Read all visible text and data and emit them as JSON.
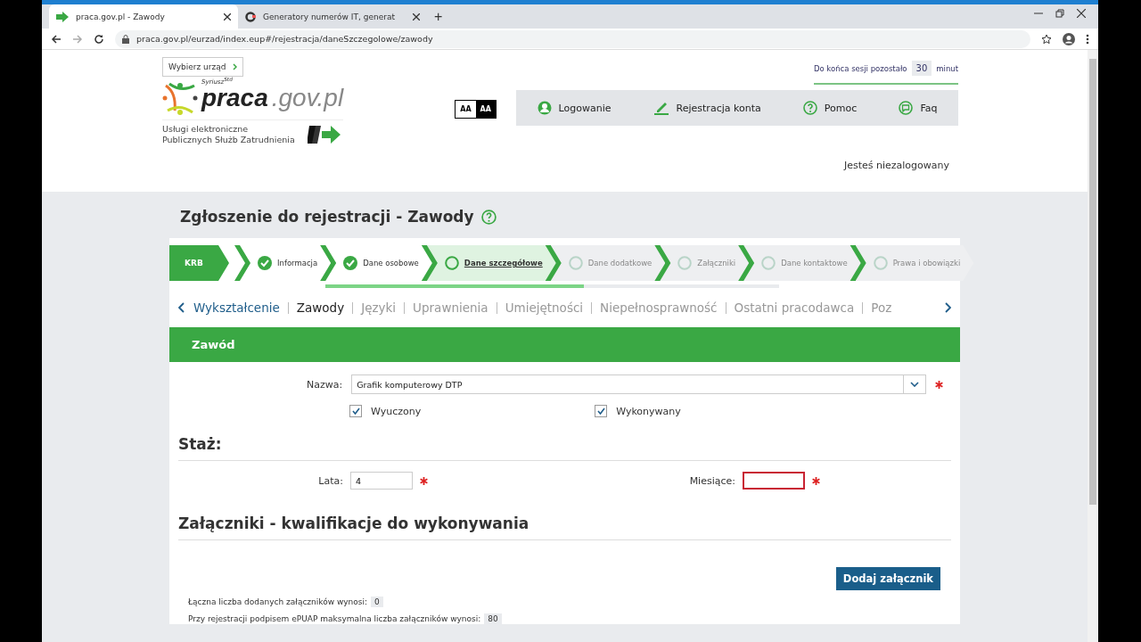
{
  "browser": {
    "tabs": [
      {
        "title": "praca.gov.pl - Zawody",
        "selected": true
      },
      {
        "title": "Generatory numerów IT, generat",
        "selected": false
      }
    ],
    "new_tab": "+",
    "address": "praca.gov.pl/eurzad/index.eup#/rejestracja/daneSzczegolowe/zawody"
  },
  "header": {
    "office_button": "Wybierz urząd",
    "logo": {
      "main": "praca",
      "domain": ".gov.pl",
      "badge": "Syriusz$^{Std}$",
      "subtitle": [
        "Usługi elektroniczne",
        "Publicznych Służb Zatrudnienia"
      ]
    },
    "contrast": [
      {
        "label": "AA",
        "selected": false
      },
      {
        "label": "AA",
        "selected": true
      }
    ],
    "session": {
      "prefix": "Do końca sesji pozostało",
      "minutes": "30",
      "suffix": "minut"
    },
    "nav": [
      {
        "label": "Logowanie"
      },
      {
        "label": "Rejestracja konta"
      },
      {
        "label": "Pomoc"
      },
      {
        "label": "Faq"
      }
    ],
    "login_status": "Jesteś niezalogowany"
  },
  "page_title": "Zgłoszenie do rejestracji - Zawody",
  "stepper": {
    "label": "KRB",
    "steps": [
      {
        "label": "Informacja",
        "completed": true,
        "selected": false
      },
      {
        "label": "Dane osobowe",
        "completed": true,
        "selected": false
      },
      {
        "label": "Dane szczegółowe",
        "completed": false,
        "selected": true
      },
      {
        "label": "Dane dodatkowe",
        "completed": false,
        "selected": false
      },
      {
        "label": "Załączniki",
        "completed": false,
        "selected": false
      },
      {
        "label": "Dane kontaktowe",
        "completed": false,
        "selected": false
      },
      {
        "label": "Prawa i obowiązki",
        "completed": false,
        "selected": false
      }
    ],
    "progress": {
      "level": 0.57
    }
  },
  "subtabs": [
    {
      "label": "Wykształcenie",
      "selected": false,
      "visited": true
    },
    {
      "label": "Zawody",
      "selected": true,
      "visited": true
    },
    {
      "label": "Języki",
      "selected": false,
      "visited": false
    },
    {
      "label": "Uprawnienia",
      "selected": false,
      "visited": false
    },
    {
      "label": "Umiejętności",
      "selected": false,
      "visited": false
    },
    {
      "label": "Niepełnosprawność",
      "selected": false,
      "visited": false
    },
    {
      "label": "Ostatni pracodawca",
      "selected": false,
      "visited": false
    },
    {
      "label": "Poz",
      "selected": false,
      "visited": false
    }
  ],
  "section": {
    "title": "Zawód",
    "name_field": {
      "label": "Nazwa:",
      "value": "Grafik komputerowy DTP",
      "required": true
    },
    "checkboxes": [
      {
        "label": "Wyuczony",
        "checked": true
      },
      {
        "label": "Wykonywany",
        "checked": true
      }
    ],
    "experience": {
      "title": "Staż:",
      "fields": [
        {
          "label": "Lata:",
          "value": "4",
          "required": true,
          "invalid": false
        },
        {
          "label": "Miesiące:",
          "required": true,
          "invalid": true
        }
      ]
    },
    "attachments": {
      "title": "Załączniki - kwalifikacje do wykonywania",
      "add_button": "Dodaj załącznik",
      "counts": [
        {
          "text": "Łączna liczba dodanych załączników wynosi:",
          "value": "0"
        },
        {
          "text": "Przy rejestracji podpisem ePUAP maksymalna liczba załączników wynosi:",
          "value": "80"
        }
      ]
    }
  }
}
